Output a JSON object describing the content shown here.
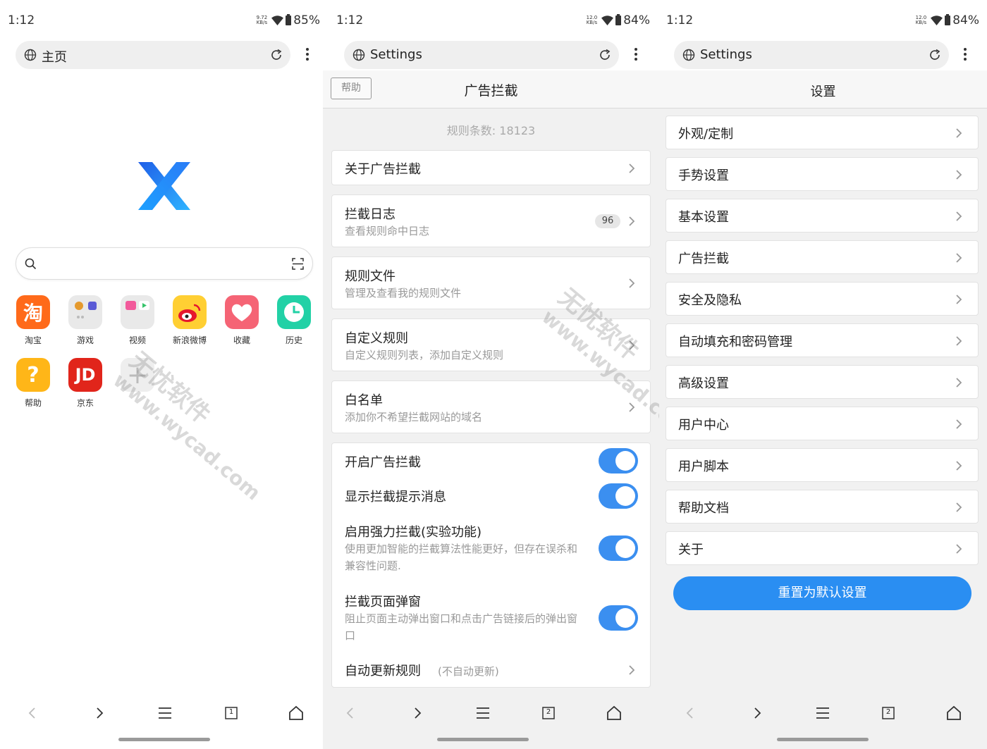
{
  "status": {
    "time": "1:12",
    "p1": {
      "speed_value": "9.72",
      "speed_unit": "KB/s",
      "battery": "85%"
    },
    "p2": {
      "speed_value": "12.0",
      "speed_unit": "KB/s",
      "battery": "84%"
    },
    "p3": {
      "speed_value": "12.0",
      "speed_unit": "KB/s",
      "battery": "84%"
    }
  },
  "home": {
    "url_label": "主页",
    "shortcuts": [
      {
        "label": "淘宝",
        "glyph": "淘",
        "color": "#ff6a1a"
      },
      {
        "label": "游戏",
        "glyph": "",
        "color": "#e9e9e9"
      },
      {
        "label": "视频",
        "glyph": "",
        "color": "#e9e9e9"
      },
      {
        "label": "新浪微博",
        "glyph": "",
        "color": "#ffcf33"
      },
      {
        "label": "收藏",
        "glyph": "♥",
        "color": "#f56475"
      },
      {
        "label": "历史",
        "glyph": "",
        "color": "#22d1a6"
      },
      {
        "label": "帮助",
        "glyph": "?",
        "color": "#ffb618"
      },
      {
        "label": "京东",
        "glyph": "JD",
        "color": "#e1251b"
      },
      {
        "label": "",
        "glyph": "+",
        "color": "#eeeeee"
      }
    ],
    "tab_count": "1"
  },
  "adblock": {
    "url_label": "Settings",
    "help_label": "帮助",
    "title": "广告拦截",
    "rule_count": "规则条数: 18123",
    "items": [
      {
        "title": "关于广告拦截",
        "subtitle": ""
      },
      {
        "title": "拦截日志",
        "subtitle": "查看规则命中日志",
        "badge": "96"
      },
      {
        "title": "规则文件",
        "subtitle": "管理及查看我的规则文件"
      },
      {
        "title": "自定义规则",
        "subtitle": "自定义规则列表，添加自定义规则"
      },
      {
        "title": "白名单",
        "subtitle": "添加你不希望拦截网站的域名"
      }
    ],
    "toggles": [
      {
        "title": "开启广告拦截",
        "desc1": "",
        "desc2": "",
        "on": true
      },
      {
        "title": "显示拦截提示消息",
        "desc1": "",
        "desc2": "",
        "on": true
      },
      {
        "title": "启用强力拦截(实验功能)",
        "desc1": "使用更加智能的拦截算法性能更好，但存在误杀和",
        "desc2": "兼容性问题.",
        "on": true
      },
      {
        "title": "拦截页面弹窗",
        "desc1": "阻止页面主动弹出窗口和点击广告链接后的弹出窗",
        "desc2": "口",
        "on": true
      }
    ],
    "auto_update": {
      "title": "自动更新规则",
      "note": "(不自动更新)"
    },
    "tab_count": "2"
  },
  "settings": {
    "url_label": "Settings",
    "title": "设置",
    "items": [
      "外观/定制",
      "手势设置",
      "基本设置",
      "广告拦截",
      "安全及隐私",
      "自动填充和密码管理",
      "高级设置",
      "用户中心",
      "用户脚本",
      "帮助文档",
      "关于"
    ],
    "reset_label": "重置为默认设置",
    "tab_count": "2"
  },
  "watermark": {
    "text": "无忧软件",
    "url": "www.wycad.com"
  },
  "colors": {
    "accent": "#2a8ef2",
    "toggle": "#3b8ff0"
  }
}
